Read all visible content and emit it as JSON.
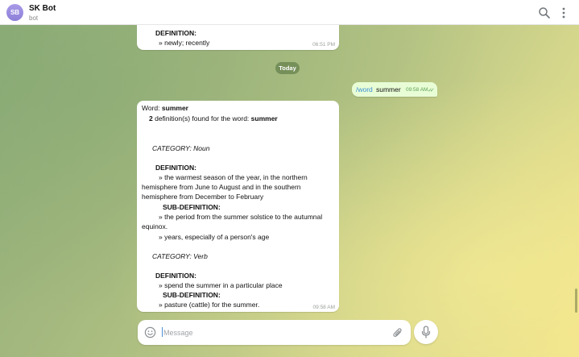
{
  "header": {
    "avatar_initials": "SB",
    "title": "SK Bot",
    "subtitle": "bot",
    "icons": [
      "search-icon",
      "more-vertical-icon"
    ]
  },
  "messages": {
    "previous": {
      "definition_label": "DEFINITION:",
      "definition_text": "» newly; recently",
      "time": "06:51 PM"
    },
    "date_divider": "Today",
    "outgoing": {
      "command": "/word",
      "text": "summer",
      "time": "09:58 AM",
      "status_icon": "double-check-icon"
    },
    "reply": {
      "word_label": "Word:",
      "word": "summer",
      "count": "2",
      "found_text": "definition(s) found for the word:",
      "found_word": "summer",
      "category1": "CATEGORY: Noun",
      "definition_label": "DEFINITION:",
      "def1_line1": "» the warmest season of the year, in the northern",
      "def1_line2": "hemisphere from June to August and in the southern",
      "def1_line3": "hemisphere from December to February",
      "subdef_label": "SUB-DEFINITION:",
      "sub1_line1": "» the period from the summer solstice to the autumnal",
      "sub1_line2": "equinox.",
      "sub2": "» years, especially of a person's age",
      "category2": "CATEGORY: Verb",
      "definition2_label": "DEFINITION:",
      "def2": "» spend the summer in a particular place",
      "subdef2_label": "SUB-DEFINITION:",
      "sub3": "» pasture (cattle) for the summer.",
      "time": "09:58 AM"
    }
  },
  "composer": {
    "placeholder": "Message",
    "icons": [
      "smile-icon",
      "paperclip-icon",
      "microphone-icon"
    ]
  },
  "colors": {
    "accent": "#3a8fd6",
    "outgoing_bubble": "#e8fdd6",
    "avatar": "#9a8ce0"
  }
}
